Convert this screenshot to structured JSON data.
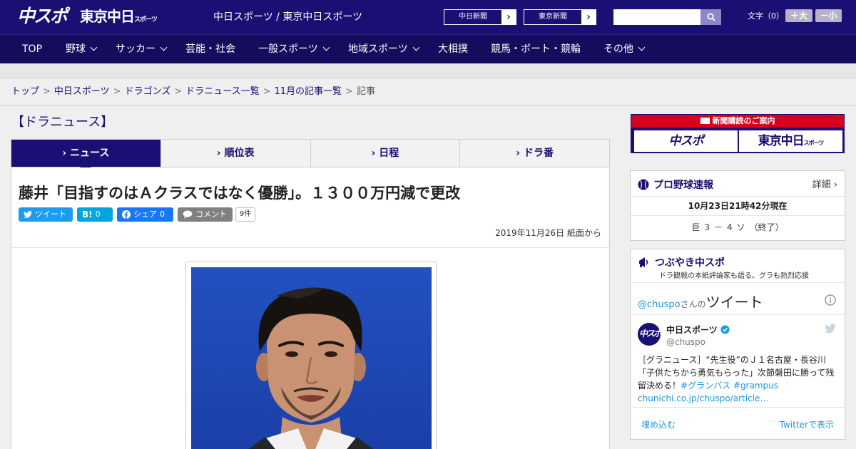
{
  "header": {
    "logo_main": "中スポ",
    "logo_tokyo": "東京中日",
    "logo_tokyo_small": "スポーツ",
    "site_names": "中日スポーツ / 東京中日スポーツ",
    "ext_links": [
      {
        "label": "中日新聞",
        "arrow": "›"
      },
      {
        "label": "東京新聞",
        "arrow": "›"
      }
    ],
    "search_placeholder": "",
    "text_size_label": "文字（0）",
    "size_up": "＋大",
    "size_down": "－小"
  },
  "nav": {
    "items": [
      {
        "label": "TOP",
        "has_menu": false
      },
      {
        "label": "野球",
        "has_menu": true
      },
      {
        "label": "サッカー",
        "has_menu": true
      },
      {
        "label": "芸能・社会",
        "has_menu": false
      },
      {
        "label": "一般スポーツ",
        "has_menu": true
      },
      {
        "label": "地域スポーツ",
        "has_menu": true
      },
      {
        "label": "大相撲",
        "has_menu": false
      },
      {
        "label": "競馬・ボート・競輪",
        "has_menu": false
      },
      {
        "label": "その他",
        "has_menu": true
      }
    ]
  },
  "breadcrumb": {
    "items": [
      "トップ",
      "中日スポーツ",
      "ドラゴンズ",
      "ドラニュース一覧",
      "11月の記事一覧"
    ],
    "current": "記事",
    "separator": ">"
  },
  "section_title": "【ドラニュース】",
  "tabs": [
    {
      "label": "ニュース",
      "active": true
    },
    {
      "label": "順位表",
      "active": false
    },
    {
      "label": "日程",
      "active": false
    },
    {
      "label": "ドラ番",
      "active": false
    }
  ],
  "article": {
    "headline": "藤井「目指すのはＡクラスではなく優勝」。１３００万円減で更改",
    "share": {
      "tweet": "ツイート",
      "hatena_label": "B!",
      "hatena_count": "0",
      "fb_share": "シェア",
      "fb_count": "0",
      "comment": "コメント",
      "comment_count": "9件"
    },
    "date": "2019年11月26日 紙面から"
  },
  "sidebar": {
    "promo": {
      "title": "新聞購読のご案内",
      "btn1": "中スポ",
      "btn2": "東京中日",
      "btn2_small": "スポーツ"
    },
    "baseball": {
      "title": "プロ野球速報",
      "detail": "詳細 ›",
      "timestamp": "10月23日21時42分現在",
      "score": "巨 ３ － ４ ソ　（終了）"
    },
    "twitter_box": {
      "title": "つぶやき中スポ",
      "subtitle": "ドラ観戦の本紙評論家も語る。グラも熱烈応援",
      "handle_link": "@chuspo",
      "handle_suffix": "さんの",
      "tweets_label": "ツイート",
      "tweet": {
        "name": "中日スポーツ",
        "handle": "@chuspo",
        "text": "［グラニュース］“先生役”のＪ１名古屋・長谷川「子供たちから勇気もらった」次節磐田に勝って残留決める！",
        "hashtags": "#グランパス #grampus",
        "link": "chunichi.co.jp/chuspo/article…"
      },
      "embed": "埋め込む",
      "view_on": "Twitterで表示"
    }
  },
  "colors": {
    "brand_navy": "#1a1073",
    "nav_navy": "#140c5c",
    "promo_red": "#d6001c",
    "twitter_blue": "#1d9bf0",
    "hatena_blue": "#00a4de",
    "facebook_blue": "#1877f2",
    "comment_gray": "#808080"
  }
}
